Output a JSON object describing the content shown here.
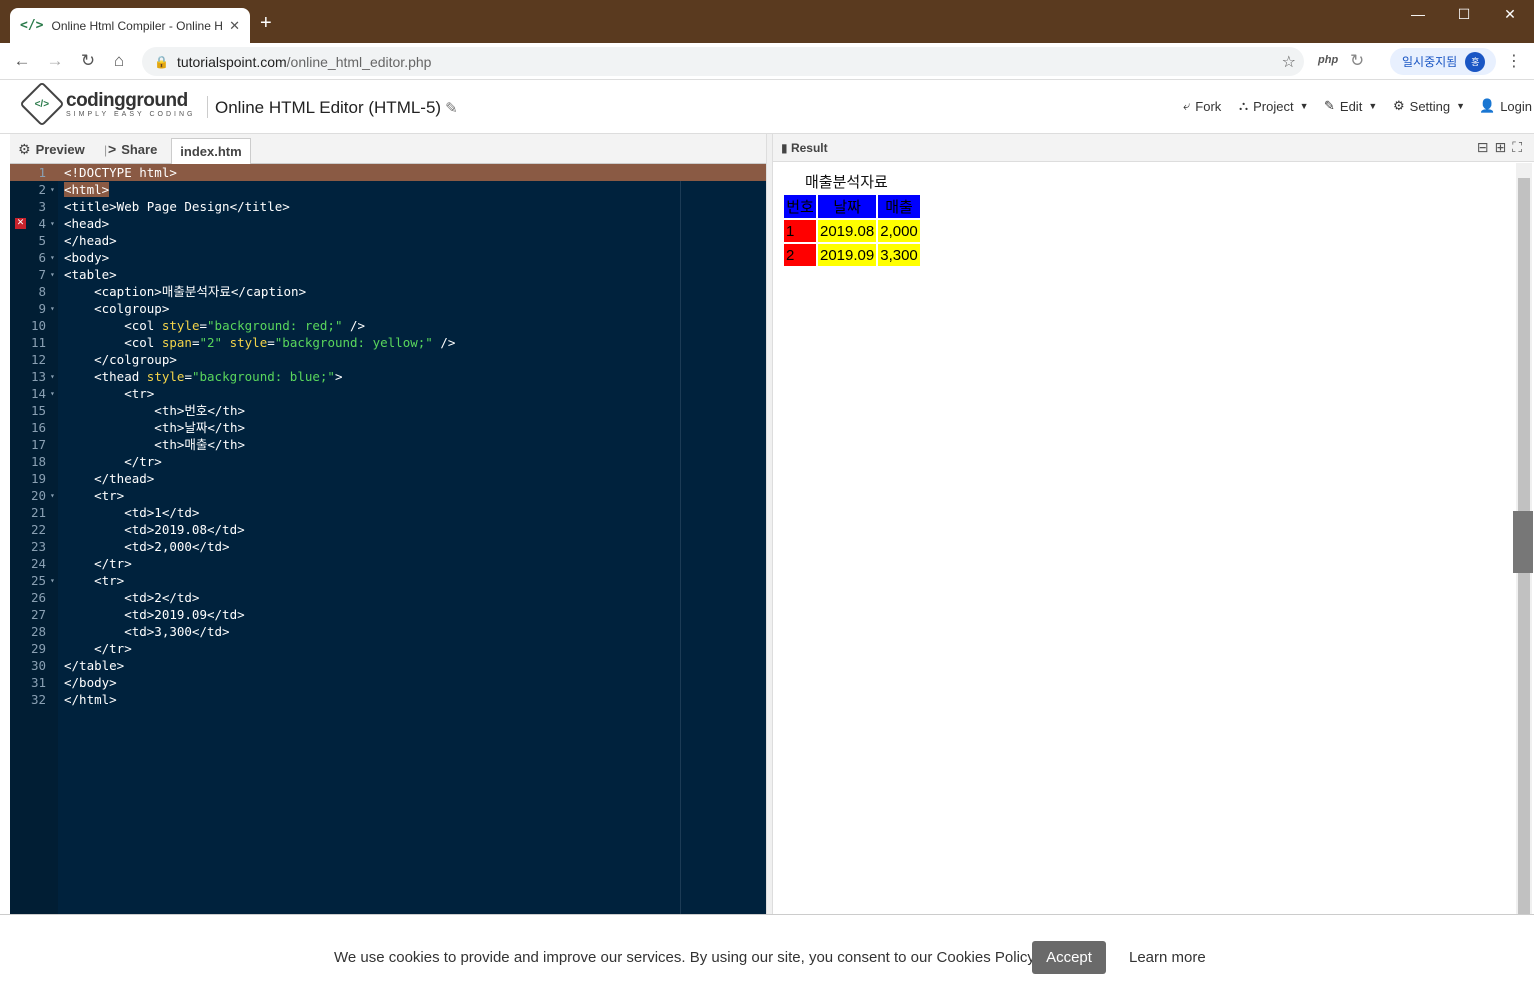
{
  "browser": {
    "tab_title": "Online Html Compiler - Online H",
    "tab_favicon": "</>",
    "url_host": "tutorialspoint.com",
    "url_path": "/online_html_editor.php",
    "ext_php": "php",
    "paused_label": "일시중지됨",
    "avatar_letter": "홍"
  },
  "header": {
    "logo_name": "codingground",
    "logo_tagline": "SIMPLY EASY CODING",
    "title": "Online HTML Editor (HTML-5)",
    "nav": {
      "fork": "Fork",
      "project": "Project",
      "edit": "Edit",
      "setting": "Setting",
      "login": "Login"
    }
  },
  "left_toolbar": {
    "preview": "Preview",
    "share": "Share",
    "file_tab": "index.htm"
  },
  "right_toolbar": {
    "result": "Result"
  },
  "editor": {
    "line_numbers": [
      "1",
      "2",
      "3",
      "4",
      "5",
      "6",
      "7",
      "8",
      "9",
      "10",
      "11",
      "12",
      "13",
      "14",
      "15",
      "16",
      "17",
      "18",
      "19",
      "20",
      "21",
      "22",
      "23",
      "24",
      "25",
      "26",
      "27",
      "28",
      "29",
      "30",
      "31",
      "32"
    ]
  },
  "result": {
    "caption": "매출분석자료",
    "headers": [
      "번호",
      "날짜",
      "매출"
    ],
    "rows": [
      [
        "1",
        "2019.08",
        "2,000"
      ],
      [
        "2",
        "2019.09",
        "3,300"
      ]
    ]
  },
  "colors": {
    "titlebar": "#5a3a1f",
    "editor_bg": "#00223d",
    "string": "#59d65c",
    "attribute": "#f3d44a",
    "th_bg": "#0000ff",
    "col1_bg": "#ff0000",
    "col23_bg": "#ffff00"
  },
  "cookie": {
    "message": "We use cookies to provide and improve our services. By using our site, you consent to our Cookies Policy.",
    "accept": "Accept",
    "learn_more": "Learn more"
  }
}
